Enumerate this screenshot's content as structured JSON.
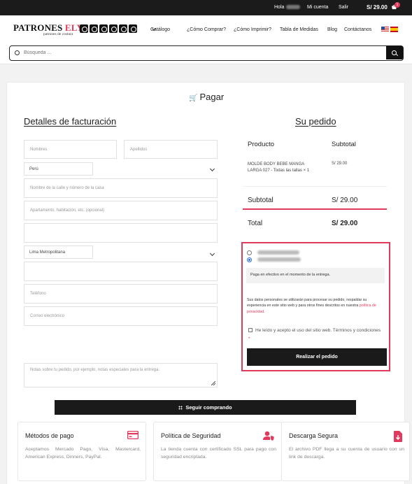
{
  "topbar": {
    "greeting": "Hola",
    "account": "Mi cuenta",
    "logout": "Salir",
    "cart_total": "S/ 29.00",
    "cart_count": "1"
  },
  "header": {
    "brand_main": "PATRONES",
    "brand_accent": "ELY",
    "tagline": "patrones de costura",
    "nav": [
      "Catálogo",
      "¿Cómo Comprar?",
      "¿Cómo Imprimir?",
      "Tabla de Medidas",
      "Blog",
      "Contáctanos"
    ],
    "social_icons": [
      "whatsapp-icon",
      "facebook-icon",
      "instagram-icon",
      "youtube-icon",
      "tiktok-icon",
      "email-icon"
    ],
    "flags": [
      "us-flag-icon",
      "es-flag-icon"
    ]
  },
  "search": {
    "placeholder": "Búsqueda ..."
  },
  "page": {
    "title": "Pagar"
  },
  "billing": {
    "title": "Detalles de facturación",
    "first_name": "Nombres",
    "last_name": "Apellidos",
    "country": "Perú",
    "street": "Nombre de la calle y número de la casa",
    "apartment": "Apartamento, habitación, etc. (opcional)",
    "city": "",
    "region": "Lima Metropolitana",
    "postcode": "",
    "phone": "Teléfono",
    "email": "Correo electrónico",
    "notes": "Notas sobre tu pedido, por ejemplo, notas especiales para la entrega."
  },
  "order": {
    "title": "Su pedido",
    "col_product": "Producto",
    "col_subtotal": "Subtotal",
    "item_name": "MOLDE BODY BEBE MANGA LARGA 027 - Todas las tallas × 1",
    "item_price": "S/ 29.00",
    "subtotal_label": "Subtotal",
    "subtotal_value": "S/ 29.00",
    "total_label": "Total",
    "total_value": "S/ 29.00"
  },
  "payment": {
    "method_desc": "Paga en efectivo en el momento de la entrega.",
    "privacy_text": "Sus datos personales se utilizarán para procesar su pedido, respaldar su experiencia en este sitio web y para otros fines descritos en nuestra",
    "privacy_link": "política de privacidad.",
    "terms_text": "He leído y acepto el uso del sitio web. Términos y condiciones",
    "terms_req": "*",
    "place_order": "Realizar el pedido"
  },
  "continue_label": "Seguir comprando",
  "info_cards": [
    {
      "title": "Métodos de pago",
      "text": "Aceptamos Mercado Pago, Visa, Mastercard, American Express, Dinners, PayPal.",
      "icon": "credit-card-icon"
    },
    {
      "title": "Política de Seguridad",
      "text": "La tienda cuenta con certificado SSL para pago con seguridad encriptada.",
      "icon": "user-shield-icon"
    },
    {
      "title": "Descarga Segura",
      "text": "El archivo PDF llega a su cuenta de usuario con un link de descarga.",
      "icon": "file-download-icon"
    }
  ],
  "colors": {
    "accent": "#e03a5c",
    "dark": "#1a1a1a"
  }
}
